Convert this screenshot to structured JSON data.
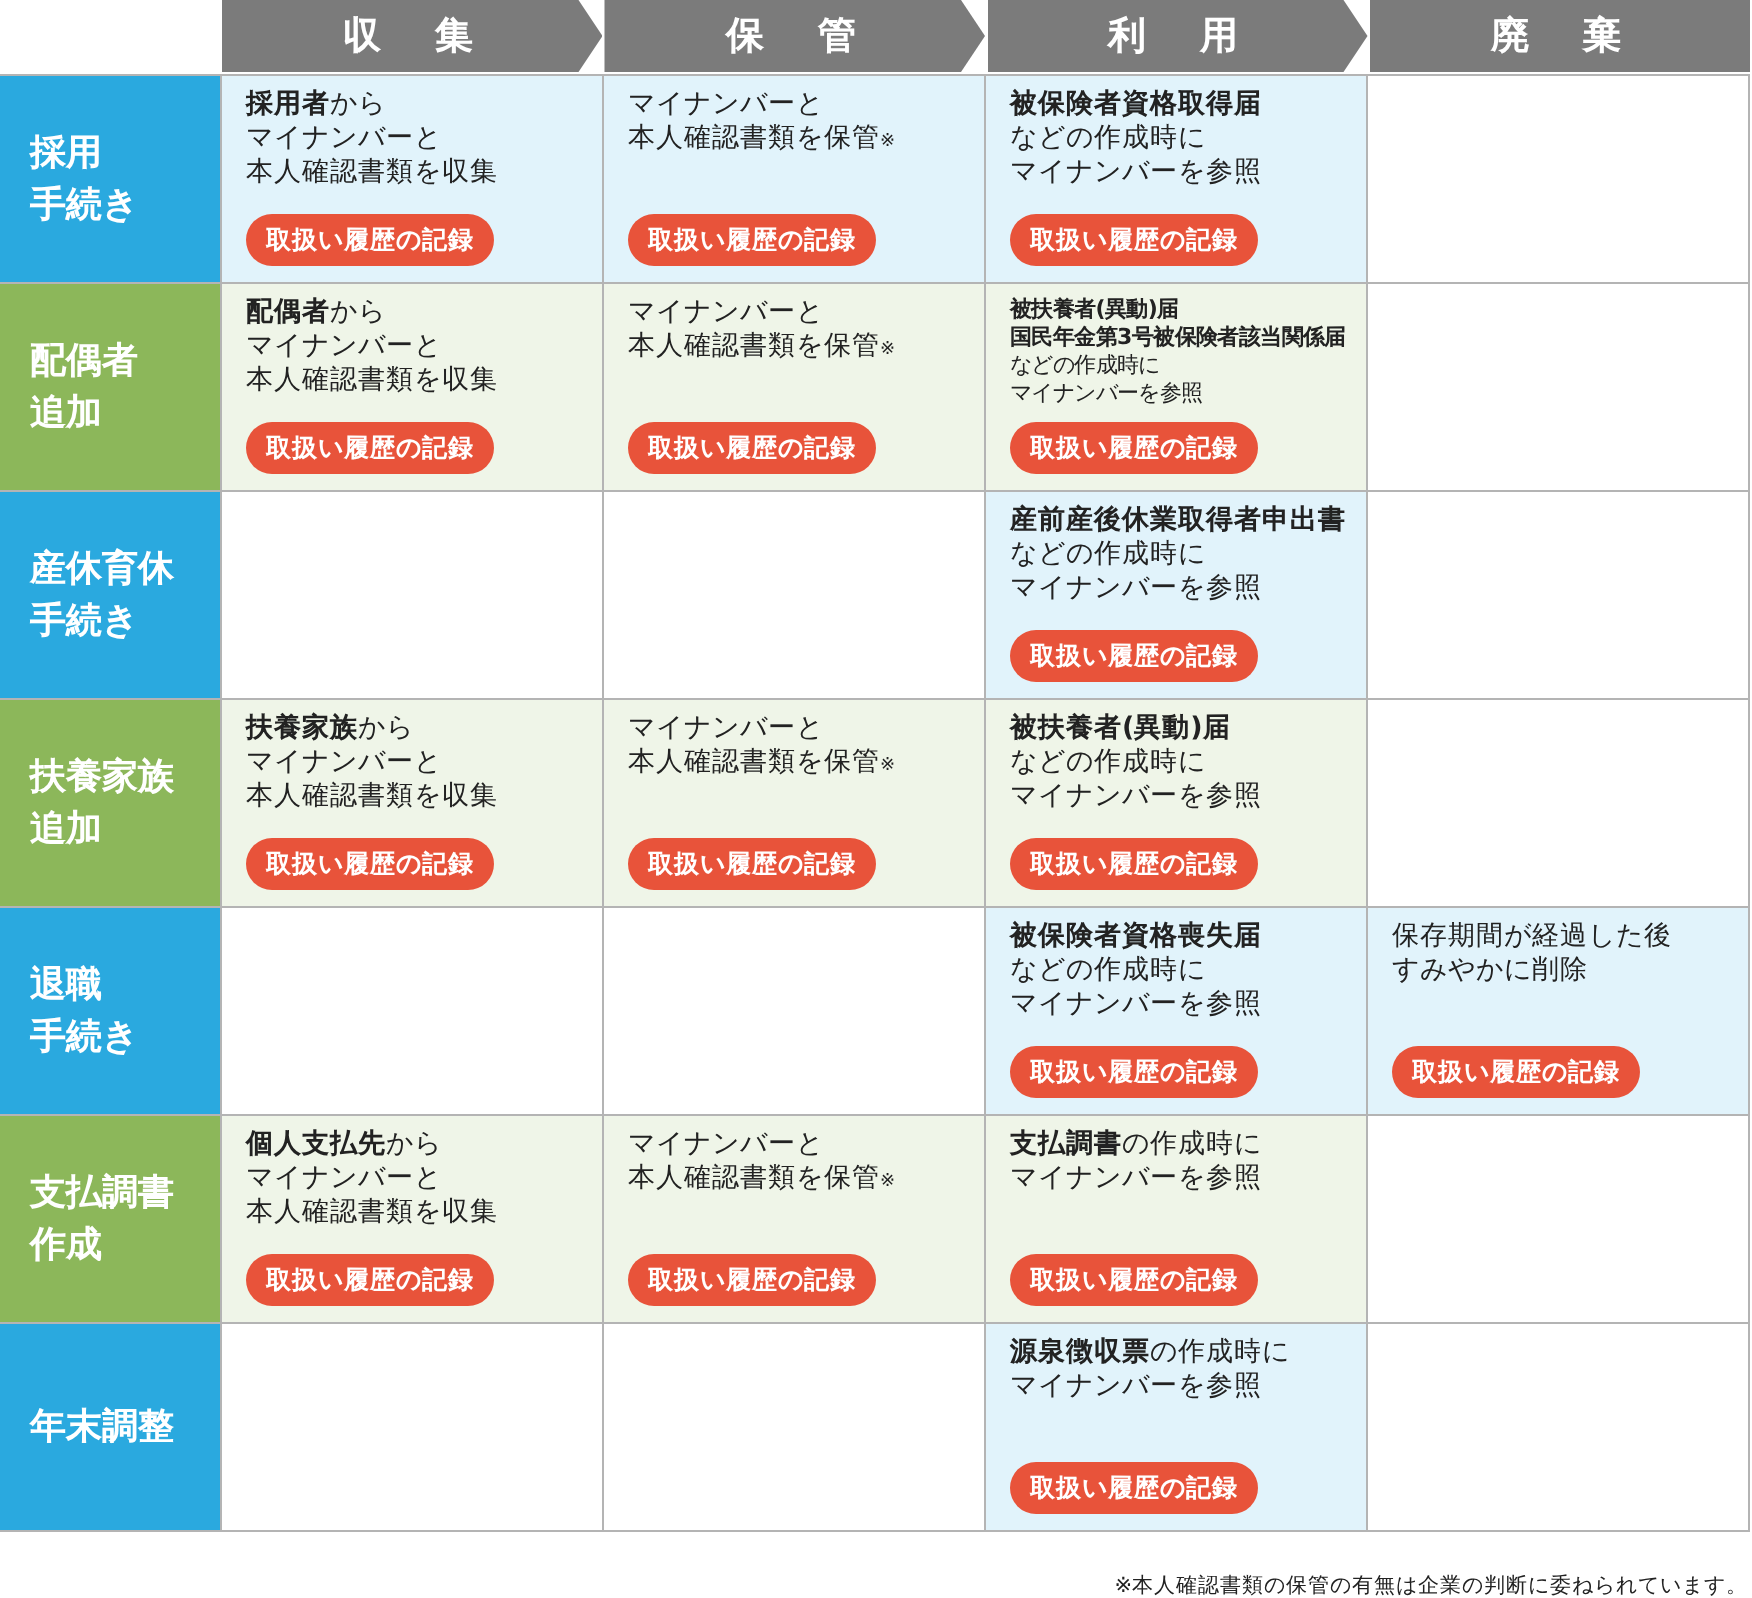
{
  "headers": [
    "収　集",
    "保　管",
    "利　用",
    "廃　棄"
  ],
  "rows": [
    {
      "label": [
        "採用",
        "手続き"
      ],
      "color": "#2aa9df",
      "cells": [
        {
          "lines": [
            "**採用者**から",
            "マイナンバーと",
            "本人確認書類を収集"
          ],
          "button": "取扱い履歴の記録"
        },
        {
          "lines": [
            "マイナンバーと",
            "本人確認書類を保管$_{※}$"
          ],
          "button": "取扱い履歴の記録"
        },
        {
          "lines": [
            "**被保険者資格取得届**",
            "などの作成時に",
            "マイナンバーを参照"
          ],
          "button": "取扱い履歴の記録"
        },
        null
      ]
    },
    {
      "label": [
        "配偶者",
        "追加"
      ],
      "color": "#8cb75a",
      "cells": [
        {
          "lines": [
            "**配偶者**から",
            "マイナンバーと",
            "本人確認書類を収集"
          ],
          "button": "取扱い履歴の記録"
        },
        {
          "lines": [
            "マイナンバーと",
            "本人確認書類を保管$_{※}$"
          ],
          "button": "取扱い履歴の記録"
        },
        {
          "compact": true,
          "lines": [
            "**被扶養者(異動)届**",
            "**国民年金第3号被保険者該当関係届**",
            "などの作成時に",
            "マイナンバーを参照"
          ],
          "button": "取扱い履歴の記録"
        },
        null
      ]
    },
    {
      "label": [
        "産休育休",
        "手続き"
      ],
      "color": "#2aa9df",
      "cells": [
        null,
        null,
        {
          "lines": [
            "**産前産後休業取得者申出書**",
            "などの作成時に",
            "マイナンバーを参照"
          ],
          "button": "取扱い履歴の記録"
        },
        null
      ]
    },
    {
      "label": [
        "扶養家族",
        "追加"
      ],
      "color": "#8cb75a",
      "cells": [
        {
          "lines": [
            "**扶養家族**から",
            "マイナンバーと",
            "本人確認書類を収集"
          ],
          "button": "取扱い履歴の記録"
        },
        {
          "lines": [
            "マイナンバーと",
            "本人確認書類を保管$_{※}$"
          ],
          "button": "取扱い履歴の記録"
        },
        {
          "lines": [
            "**被扶養者(異動)届**",
            "などの作成時に",
            "マイナンバーを参照"
          ],
          "button": "取扱い履歴の記録"
        },
        null
      ]
    },
    {
      "label": [
        "退職",
        "手続き"
      ],
      "color": "#2aa9df",
      "cells": [
        null,
        null,
        {
          "lines": [
            "**被保険者資格喪失届**",
            "などの作成時に",
            "マイナンバーを参照"
          ],
          "button": "取扱い履歴の記録"
        },
        {
          "lines": [
            "保存期間が経過した後",
            "すみやかに削除"
          ],
          "button": "取扱い履歴の記録"
        }
      ]
    },
    {
      "label": [
        "支払調書",
        "作成"
      ],
      "color": "#8cb75a",
      "cells": [
        {
          "lines": [
            "**個人支払先**から",
            "マイナンバーと",
            "本人確認書類を収集"
          ],
          "button": "取扱い履歴の記録"
        },
        {
          "lines": [
            "マイナンバーと",
            "本人確認書類を保管$_{※}$"
          ],
          "button": "取扱い履歴の記録"
        },
        {
          "lines": [
            "**支払調書**の作成時に",
            "マイナンバーを参照"
          ],
          "button": "取扱い履歴の記録"
        },
        null
      ]
    },
    {
      "label": [
        "年末調整"
      ],
      "color": "#2aa9df",
      "cells": [
        null,
        null,
        {
          "lines": [
            "**源泉徴収票**の作成時に",
            "マイナンバーを参照"
          ],
          "button": "取扱い履歴の記録"
        },
        null
      ]
    }
  ],
  "footnote": "※本人確認書類の保管の有無は企業の判断に委ねられています。"
}
